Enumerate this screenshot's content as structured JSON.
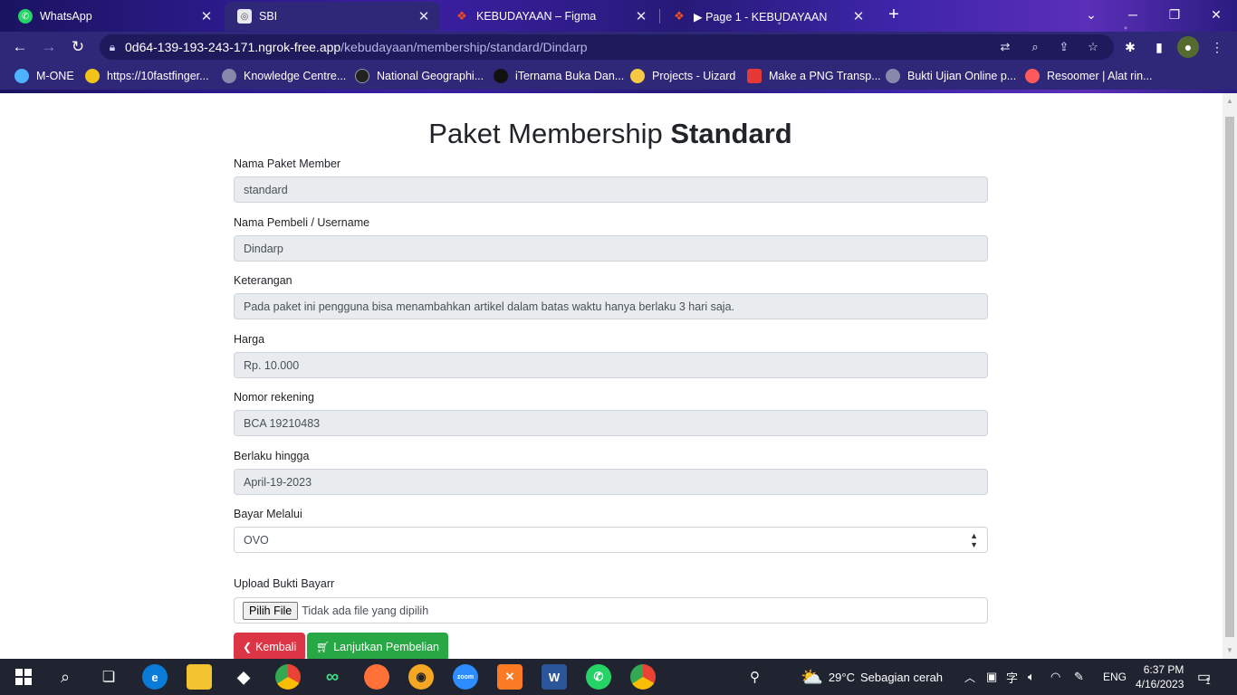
{
  "browser": {
    "tabs": [
      {
        "title": "WhatsApp",
        "icon": "whatsapp-icon",
        "active": false
      },
      {
        "title": "SBI",
        "icon": "site-icon",
        "active": true
      },
      {
        "title": "KEBUDAYAAN – Figma",
        "icon": "figma-icon",
        "active": false
      },
      {
        "title": "▶ Page 1 - KEBUDAYAAN",
        "icon": "figma-icon",
        "active": false
      }
    ],
    "url_host": "0d64-139-193-243-171.ngrok-free.app",
    "url_path": "/kebudayaan/membership/standard/Dindarp",
    "bookmarks": [
      {
        "label": "M-ONE",
        "color": "#4db2ff"
      },
      {
        "label": "https://10fastfinger...",
        "color": "#f0c419"
      },
      {
        "label": "Knowledge Centre...",
        "color": "#8888aa"
      },
      {
        "label": "National Geographi...",
        "color": "#222222"
      },
      {
        "label": "iTernama Buka Dan...",
        "color": "#111111"
      },
      {
        "label": "Projects - Uizard",
        "color": "#f7c843"
      },
      {
        "label": "Make a PNG Transp...",
        "color": "#e53935"
      },
      {
        "label": "Bukti Ujian Online p...",
        "color": "#8888aa"
      },
      {
        "label": "Resoomer | Alat rin...",
        "color": "#ff5a5a"
      }
    ]
  },
  "page": {
    "title_prefix": "Paket Membership",
    "title_bold": "Standard",
    "fields": [
      {
        "label": "Nama Paket Member",
        "value": "standard"
      },
      {
        "label": "Nama Pembeli / Username",
        "value": "Dindarp"
      },
      {
        "label": "Keterangan",
        "value": "Pada paket ini pengguna bisa menambahkan artikel dalam batas waktu hanya berlaku 3 hari saja."
      },
      {
        "label": "Harga",
        "value": "Rp. 10.000"
      },
      {
        "label": "Nomor rekening",
        "value": "BCA 19210483"
      },
      {
        "label": "Berlaku hingga",
        "value": "April-19-2023"
      }
    ],
    "payment": {
      "label": "Bayar Melalui",
      "selected": "OVO"
    },
    "upload": {
      "label": "Upload Bukti Bayarr",
      "button": "Pilih File",
      "status": "Tidak ada file yang dipilih"
    },
    "buttons": {
      "back": "Kembali",
      "continue": "Lanjutkan Pembelian"
    }
  },
  "taskbar": {
    "weather_temp": "29°C",
    "weather_text": "Sebagian cerah",
    "language": "ENG",
    "time": "6:37 PM",
    "date": "4/16/2023",
    "notifications": "1"
  }
}
